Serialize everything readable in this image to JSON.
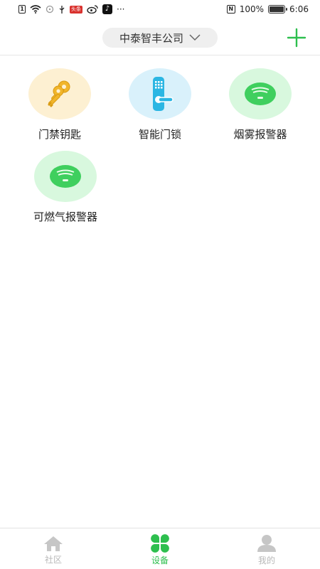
{
  "status_bar": {
    "left_box": "1",
    "red_badge": "头条",
    "tiktok": "♪",
    "more": "···",
    "nfc": "N",
    "battery_text": "100%",
    "battery_level": 1.0,
    "time": "6:06"
  },
  "header": {
    "company_name": "中泰智丰公司"
  },
  "devices": [
    {
      "label": "门禁钥匙",
      "icon": "keys-icon",
      "bg": "#fdf0d2"
    },
    {
      "label": "智能门锁",
      "icon": "smart-lock-icon",
      "bg": "#d9f1fb"
    },
    {
      "label": "烟雾报警器",
      "icon": "smoke-detector-icon",
      "bg": "#d8f8de"
    },
    {
      "label": "可燃气报警器",
      "icon": "gas-detector-icon",
      "bg": "#d8f8de"
    }
  ],
  "bottom_nav": {
    "items": [
      {
        "label": "社区",
        "icon": "home-icon",
        "active": false
      },
      {
        "label": "设备",
        "icon": "clover-icon",
        "active": true
      },
      {
        "label": "我的",
        "icon": "user-icon",
        "active": false
      }
    ]
  },
  "colors": {
    "accent": "#2dbf4e",
    "inactive": "#b8b8b8"
  }
}
